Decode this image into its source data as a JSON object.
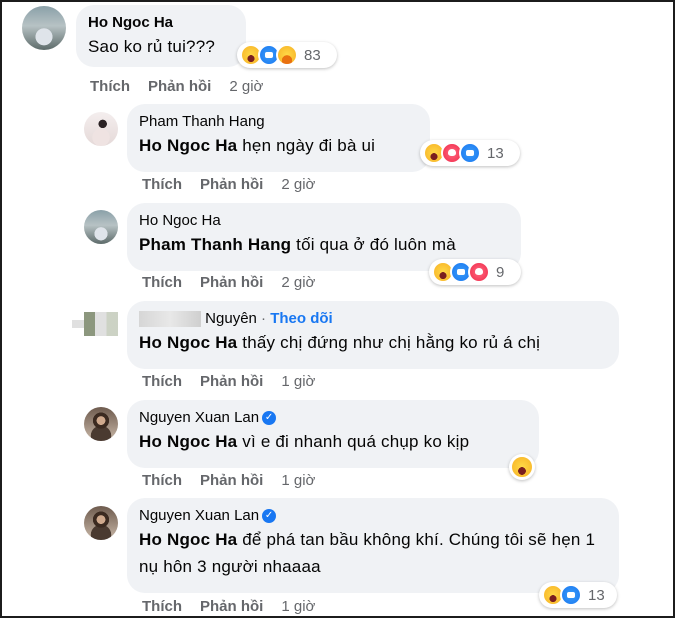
{
  "comments": [
    {
      "author": "Ho Ngoc Ha",
      "text": "Sao ko rủ tui???",
      "reaction_count": "83",
      "actions": {
        "like": "Thích",
        "reply": "Phản hồi",
        "time": "2 giờ"
      }
    },
    {
      "author": "Pham Thanh Hang",
      "mention": "Ho Ngoc Ha",
      "text": " hẹn ngày đi bà ui",
      "reaction_count": "13",
      "actions": {
        "like": "Thích",
        "reply": "Phản hồi",
        "time": "2 giờ"
      }
    },
    {
      "author": "Ho Ngoc Ha",
      "mention": "Pham Thanh Hang",
      "text": " tối qua ở đó luôn mà",
      "reaction_count": "9",
      "actions": {
        "like": "Thích",
        "reply": "Phản hồi",
        "time": "2 giờ"
      }
    },
    {
      "author": "Nguyên",
      "separator": "·",
      "follow": "Theo dõi",
      "mention": "Ho Ngoc Ha",
      "text": " thấy chị đứng như chị hằng ko rủ á chị",
      "actions": {
        "like": "Thích",
        "reply": "Phản hồi",
        "time": "1 giờ"
      }
    },
    {
      "author": "Nguyen Xuan Lan",
      "mention": "Ho Ngoc Ha",
      "text": " vì e đi nhanh quá chụp ko kịp",
      "actions": {
        "like": "Thích",
        "reply": "Phản hồi",
        "time": "1 giờ"
      }
    },
    {
      "author": "Nguyen Xuan Lan",
      "mention": "Ho Ngoc Ha",
      "text": " để phá tan bầu không khí. Chúng tôi sẽ hẹn 1 nụ hôn 3 người nhaaaa",
      "reaction_count": "13",
      "actions": {
        "like": "Thích",
        "reply": "Phản hồi",
        "time": "1 giờ"
      }
    }
  ],
  "colors": {
    "bubble": "#f0f2f5",
    "link": "#1877f2",
    "meta": "#65676b"
  },
  "icons": [
    "haha-icon",
    "like-icon",
    "love-icon",
    "care-icon",
    "verified-badge-icon"
  ]
}
